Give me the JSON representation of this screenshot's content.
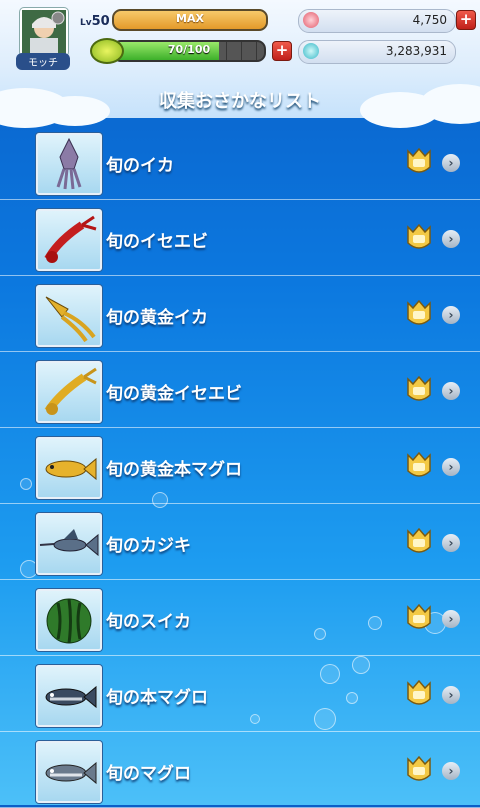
{
  "player": {
    "name": "モッチ",
    "level_prefix": "Lv",
    "level": "50",
    "exp_label": "MAX",
    "stamina_text": "70/100",
    "stamina_fraction": 0.7
  },
  "currency": {
    "gems": "4,750",
    "coins": "3,283,931"
  },
  "page_title": "収集おさかなリスト",
  "items": [
    {
      "label": "旬のイカ",
      "icon": "squid-icon"
    },
    {
      "label": "旬のイセエビ",
      "icon": "lobster-icon"
    },
    {
      "label": "旬の黄金イカ",
      "icon": "golden-squid-icon"
    },
    {
      "label": "旬の黄金イセエビ",
      "icon": "golden-lobster-icon"
    },
    {
      "label": "旬の黄金本マグロ",
      "icon": "golden-tuna-icon"
    },
    {
      "label": "旬のカジキ",
      "icon": "marlin-icon"
    },
    {
      "label": "旬のスイカ",
      "icon": "watermelon-icon"
    },
    {
      "label": "旬の本マグロ",
      "icon": "bluefin-tuna-icon"
    },
    {
      "label": "旬のマグロ",
      "icon": "tuna-icon"
    }
  ],
  "colors": {
    "accent_gold": "#e3b43a",
    "plus_red": "#d6322a"
  }
}
